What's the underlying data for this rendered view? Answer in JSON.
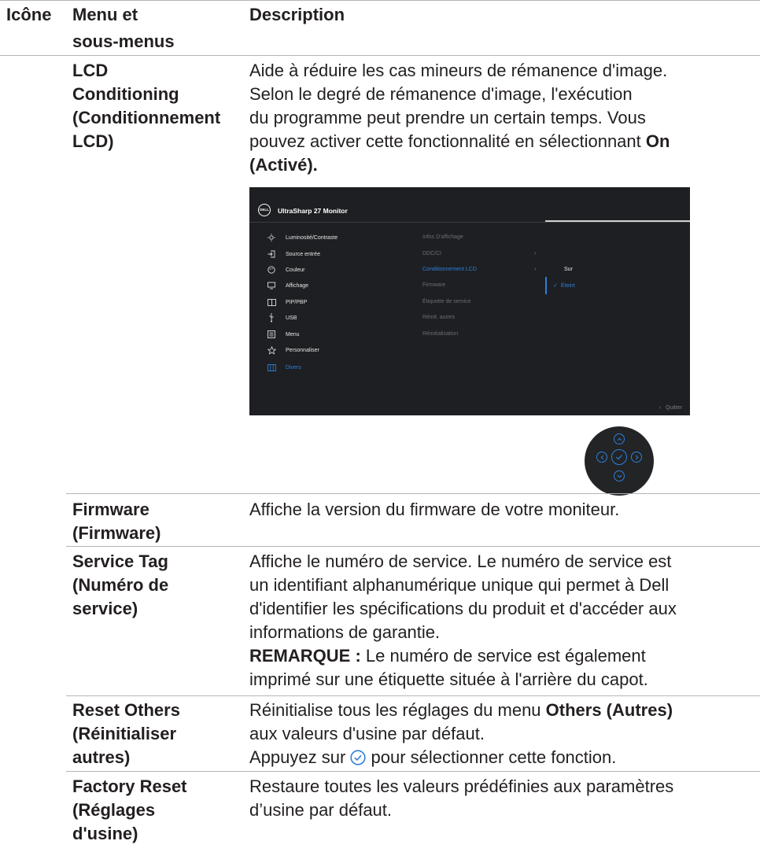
{
  "header": {
    "col_icon": "Icône",
    "col_menu_line1": "Menu et",
    "col_menu_line2": "sous-menus",
    "col_desc": "Description"
  },
  "rows": [
    {
      "menu": [
        "LCD",
        "Conditioning",
        "(Conditionnement",
        "LCD)"
      ],
      "desc_lines": [
        "Aide à réduire les cas mineurs de rémanence d'image.",
        "Selon le degré de rémanence d'image, l'exécution",
        "du programme peut prendre un certain temps. Vous"
      ],
      "desc_line4_pre": "pouvez activer cette fonctionnalité en sélectionnant ",
      "desc_line4_bold": "On",
      "desc_line5_bold": "(Activé)."
    },
    {
      "menu": [
        "Firmware",
        "(Firmware)"
      ],
      "desc": "Affiche la version du firmware de votre moniteur."
    },
    {
      "menu": [
        "Service Tag",
        "(Numéro de",
        "service)"
      ],
      "desc_lines": [
        "Affiche le numéro de service. Le numéro de service est",
        "un identifiant alphanumérique unique qui permet à Dell",
        "d'identifier les spécifications du produit et d'accéder aux",
        "informations de garantie."
      ],
      "note_label": "REMARQUE :",
      "note_lines": [
        " Le numéro de service est également",
        "imprimé sur une étiquette située à l'arrière du capot."
      ]
    },
    {
      "menu": [
        "Reset Others",
        "(Réinitialiser",
        "autres)"
      ],
      "desc_line1_pre": "Réinitialise tous les réglages du menu ",
      "desc_line1_bold": "Others (Autres)",
      "desc_line2": "aux valeurs d'usine par défaut.",
      "desc_line3_pre": "Appuyez sur ",
      "desc_line3_post": " pour sélectionner cette fonction."
    },
    {
      "menu": [
        "Factory Reset",
        "(Réglages",
        "d'usine)"
      ],
      "desc_lines": [
        "Restaure toutes les valeurs prédéfinies aux paramètres",
        "d’usine par défaut."
      ]
    }
  ],
  "osd": {
    "logo": "DELL",
    "title": "UltraSharp 27 Monitor",
    "menu_items": [
      {
        "label": "Luminosité/Contraste",
        "icon": "brightness-icon"
      },
      {
        "label": "Source entrée",
        "icon": "input-source-icon"
      },
      {
        "label": "Couleur",
        "icon": "color-icon"
      },
      {
        "label": "Affichage",
        "icon": "display-icon"
      },
      {
        "label": "PIP/PBP",
        "icon": "pip-icon"
      },
      {
        "label": "USB",
        "icon": "usb-icon"
      },
      {
        "label": "Menu",
        "icon": "menu-icon"
      },
      {
        "label": "Personnaliser",
        "icon": "star-icon"
      },
      {
        "label": "Divers",
        "icon": "others-icon"
      }
    ],
    "selected_menu": "Divers",
    "submenu": [
      "Infos D'affichage",
      "DDC/CI",
      "Conditionnement LCD",
      "Firmware",
      "Étiquette de service",
      "Réinit. autres",
      "Réinitialisation"
    ],
    "selected_submenu": "Conditionnement LCD",
    "options": [
      "Sur",
      "Éteint"
    ],
    "selected_option": "Éteint",
    "quit": "Quitter"
  },
  "colors": {
    "accent": "#2f7fd8",
    "osd_bg": "#1d1f22",
    "rule": "#b5b5b5"
  }
}
